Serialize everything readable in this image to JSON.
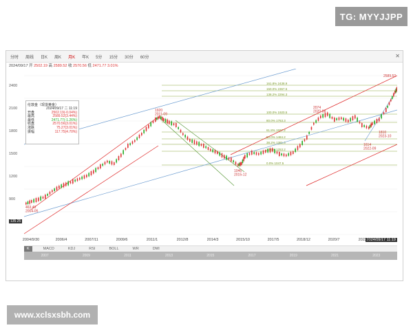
{
  "watermark_top": "TG: MYYJJPP",
  "watermark_bottom": "www.xclsxsbh.com",
  "toolbar": {
    "items": [
      "分时",
      "周线",
      "日K",
      "周K",
      "月K",
      "年K",
      "5分",
      "15分",
      "30分",
      "60分"
    ],
    "active_index": 4
  },
  "quote": {
    "date": "2024/09/17",
    "open_label": "开",
    "open": "2502.19",
    "high_label": "高",
    "high": "2589.52",
    "close_label": "收",
    "close": "2570.56",
    "low_label": "低",
    "low": "2471.77",
    "change": "3.01%"
  },
  "info_box": {
    "title": "伦敦金（现货黄金）",
    "rows": [
      {
        "label": "",
        "value": "2024/09/17 二 11:19"
      },
      {
        "label": "开盘",
        "value": "2502.19(-0.04%)"
      },
      {
        "label": "最高",
        "value": "2589.52(3.44%)"
      },
      {
        "label": "最低",
        "value": "2471.77(-1.26%)"
      },
      {
        "label": "收盘",
        "value": "2570.56(3.01%)"
      },
      {
        "label": "涨跌",
        "value": "75.27(3.01%)"
      },
      {
        "label": "振幅",
        "value": "117.75(4.70%)"
      }
    ]
  },
  "y_ticks": [
    "2400",
    "2100",
    "1800",
    "1500",
    "1200",
    "900",
    "600"
  ],
  "y_lowleft": "135.25\n-67.68%",
  "x_ticks": [
    "2004/9/30",
    "2006/4",
    "2007/11",
    "2009/6",
    "2011/1",
    "2012/8",
    "2014/3",
    "2015/10",
    "2017/5",
    "2018/12",
    "2020/7",
    "2022/2"
  ],
  "x_end": "2024/09/17 11:19",
  "annotations": [
    {
      "text": "1920\n2011-09"
    },
    {
      "text": "2074\n2020-08"
    },
    {
      "text": "2589.52"
    },
    {
      "text": "1614\n2022-09"
    },
    {
      "text": "1810\n2023-10"
    },
    {
      "text": "1046\n2015-12"
    },
    {
      "text": "463.40\n2004-05"
    }
  ],
  "fib_labels": [
    "161.8% 2438.9",
    "150.0% 2367.5",
    "138.2% 2294.3",
    "100.0% 1920.5",
    "80.0% 1763.3",
    "61.8% 1597.2",
    "50.0% 1484.2",
    "38.2% 1381.3",
    "23.6% 1253.2",
    "0.0% 1047.5"
  ],
  "indicator_tabs": [
    "K",
    "MACD",
    "KDJ",
    "RSI",
    "BOLL",
    "WR",
    "DMI"
  ],
  "indicator_active": 0,
  "navigator_years": [
    "2007",
    "2009",
    "2011",
    "2013",
    "2015",
    "2017",
    "2019",
    "2021",
    "2023"
  ],
  "colors": {
    "up": "#d33",
    "down": "#2a2",
    "fib": "#8aa83a",
    "channel_red": "#d22",
    "channel_blue": "#6a9bd0",
    "channel_green": "#5a9a3a"
  },
  "icons": [
    "pin-icon"
  ]
}
